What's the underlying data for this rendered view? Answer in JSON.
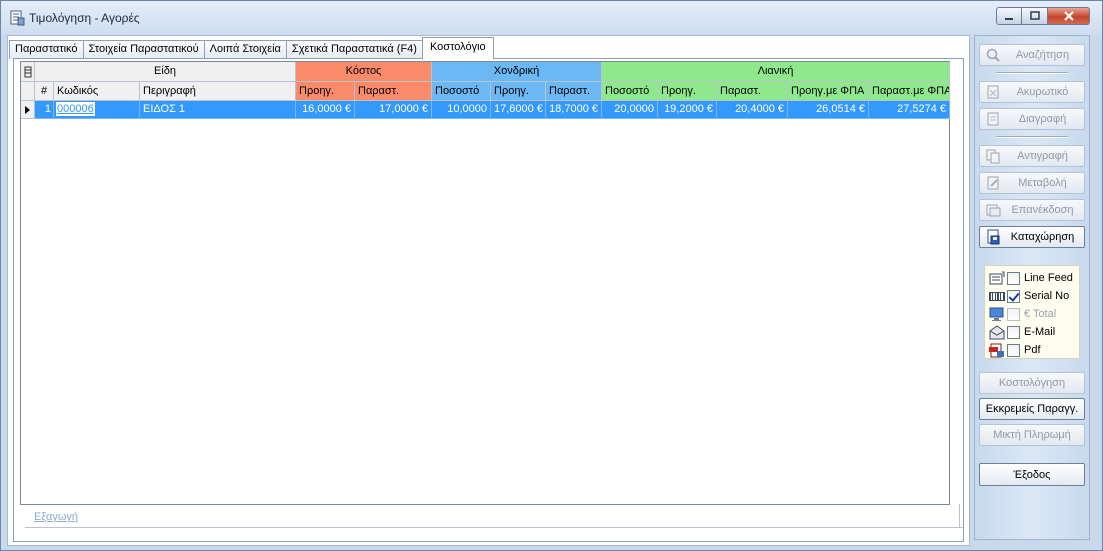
{
  "window": {
    "title": "Τιμολόγηση - Αγορές"
  },
  "tabs": [
    {
      "label": "Παραστατικό"
    },
    {
      "label": "Στοιχεία Παραστατικού"
    },
    {
      "label": "Λοιπά Στοιχεία"
    },
    {
      "label": "Σχετικά Παραστατικά (F4)"
    },
    {
      "label": "Κοστολόγιο",
      "active": true
    }
  ],
  "grid": {
    "groups": {
      "items": "Είδη",
      "cost": "Κόστος",
      "wholesale": "Χονδρική",
      "retail": "Λιανική"
    },
    "columns": {
      "num": "#",
      "code": "Κωδικός",
      "desc": "Περιγραφή",
      "cost_prev": "Προηγ.",
      "cost_doc": "Παραστ.",
      "wh_pct": "Ποσοστό",
      "wh_prev": "Προηγ.",
      "wh_doc": "Παραστ.",
      "ret_pct": "Ποσοστό",
      "ret_prev": "Προηγ.",
      "ret_doc": "Παραστ.",
      "ret_prev_vat": "Προηγ.με ΦΠΑ",
      "ret_doc_vat": "Παραστ.με ΦΠΑ"
    },
    "rows": [
      {
        "num": "1",
        "code": "000006",
        "desc": "ΕΙΔΟΣ 1",
        "cost_prev": "16,0000 €",
        "cost_doc": "17,0000 €",
        "wh_pct": "10,0000",
        "wh_prev": "17,6000 €",
        "wh_doc": "18,7000 €",
        "ret_pct": "20,0000",
        "ret_prev": "19,2000 €",
        "ret_doc": "20,4000 €",
        "ret_prev_vat": "26,0514 €",
        "ret_doc_vat": "27,5274 €"
      }
    ]
  },
  "footer": {
    "export_link": "Εξαγωγή"
  },
  "side": {
    "search": "Αναζήτηση",
    "cancel": "Ακυρωτικό",
    "delete": "Διαγραφή",
    "copy": "Αντιγραφή",
    "modify": "Μεταβολή",
    "reissue": "Επανέκδοση",
    "save": "Καταχώρηση",
    "options": {
      "line_feed": "Line Feed",
      "serial_no": "Serial No",
      "total": "€ Total",
      "email": "E-Mail",
      "pdf": "Pdf"
    },
    "costing": "Κοστολόγηση",
    "pending": "Εκκρεμείς Παραγγ.",
    "mixed_payment": "Μικτή Πληρωμή",
    "exit": "Έξοδος"
  },
  "colors": {
    "cost": "#f98b6b",
    "wholesale": "#6cb8f4",
    "retail": "#8fe88c",
    "selection": "#3399ff"
  }
}
